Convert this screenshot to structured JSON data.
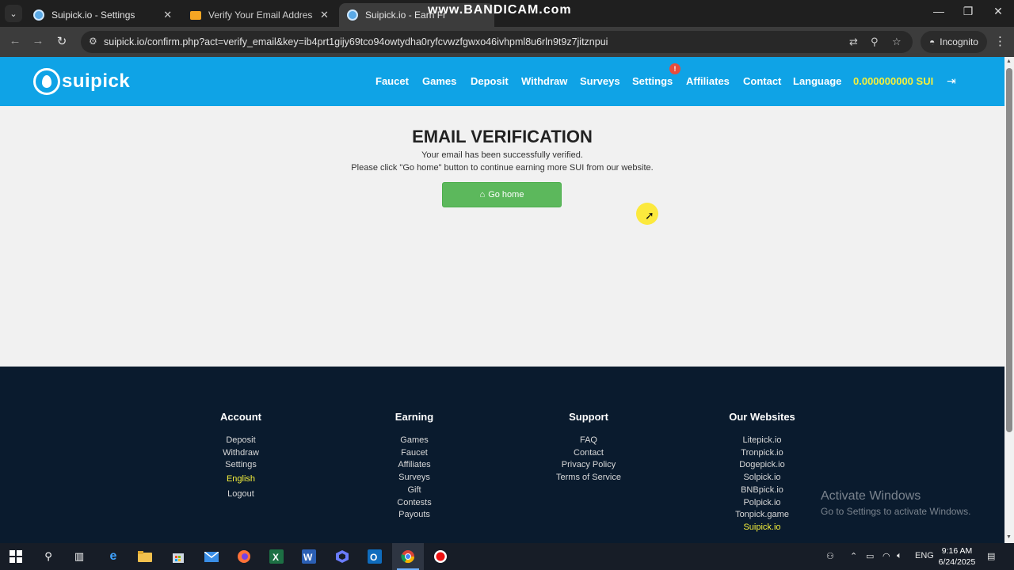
{
  "browser": {
    "tabs": [
      {
        "title": "Suipick.io - Settings",
        "active": false
      },
      {
        "title": "Verify Your Email Address - Tem",
        "active": false
      },
      {
        "title": "Suipick.io - Earn Fr",
        "active": true
      }
    ],
    "watermark": "www.BANDICAM.com",
    "url": "suipick.io/confirm.php?act=verify_email&key=ib4prt1gijy69tco94owtydha0ryfcvwzfgwxo46ivhpml8u6rln9t9z7jitznpui",
    "incognito_label": "Incognito"
  },
  "site": {
    "logo_text": "suipick",
    "nav": {
      "faucet": "Faucet",
      "games": "Games",
      "deposit": "Deposit",
      "withdraw": "Withdraw",
      "surveys": "Surveys",
      "settings": "Settings",
      "settings_badge": "!",
      "affiliates": "Affiliates",
      "contact": "Contact",
      "language": "Language",
      "balance": "0.000000000 SUI"
    },
    "page": {
      "title": "EMAIL VERIFICATION",
      "line1": "Your email has been successfully verified.",
      "line2": "Please click \"Go home\" button to continue earning more SUI from our website.",
      "button": "Go home"
    },
    "footer": {
      "account": {
        "heading": "Account",
        "links": [
          "Deposit",
          "Withdraw",
          "Settings",
          "English",
          "Logout"
        ]
      },
      "earning": {
        "heading": "Earning",
        "links": [
          "Games",
          "Faucet",
          "Affiliates",
          "Surveys",
          "Gift",
          "Contests",
          "Payouts"
        ]
      },
      "support": {
        "heading": "Support",
        "links": [
          "FAQ",
          "Contact",
          "Privacy Policy",
          "Terms of Service"
        ]
      },
      "websites": {
        "heading": "Our Websites",
        "links": [
          "Litepick.io",
          "Tronpick.io",
          "Dogepick.io",
          "Solpick.io",
          "BNBpick.io",
          "Polpick.io",
          "Tonpick.game",
          "Suipick.io"
        ]
      }
    }
  },
  "os": {
    "activate_title": "Activate Windows",
    "activate_sub": "Go to Settings to activate Windows.",
    "language": "ENG",
    "time": "9:16 AM",
    "date": "6/24/2025"
  },
  "colors": {
    "nav_bg": "#0fa3e6",
    "balance": "#f5f03c",
    "button": "#5cb85c",
    "footer_bg": "#0a1b2e"
  }
}
